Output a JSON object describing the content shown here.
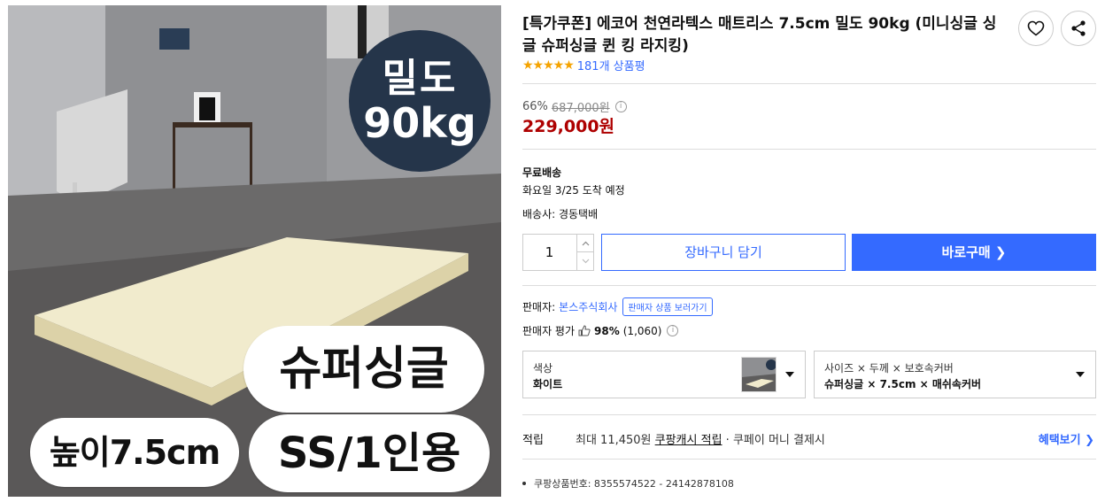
{
  "product_image": {
    "badge_line1": "밀도",
    "badge_line2": "90kg",
    "type_label": "슈퍼싱글",
    "height_label": "높이7.5cm",
    "size_label": "SS/1인용"
  },
  "product": {
    "title": "[특가쿠폰] 에코어 천연라텍스 매트리스 7.5cm 밀도 90kg (미니싱글 싱글 슈퍼싱글 퀸 킹 라지킹)",
    "stars": "★★★★★",
    "review_count": "181개 상품평"
  },
  "actions": {
    "wishlist_icon": "heart-icon",
    "share_icon": "share-icon"
  },
  "price": {
    "discount_rate": "66%",
    "original": "687,000원",
    "sale": "229,000원",
    "info_icon": "i"
  },
  "shipping": {
    "free": "무료배송",
    "arrival": "화요일 3/25 도착 예정",
    "carrier": "배송사: 경동택배"
  },
  "purchase": {
    "quantity": "1",
    "cart_label": "장바구니 담기",
    "buy_label": "바로구매 ❯"
  },
  "seller": {
    "label": "판매자:",
    "name": "본스주식회사",
    "more_label": "판매자 상품 보러가기",
    "rating_label": "판매자 평가",
    "rating_pct": "98%",
    "rating_count": "(1,060)"
  },
  "options": {
    "color": {
      "label": "색상",
      "value": "화이트"
    },
    "size": {
      "label": "사이즈 × 두께 × 보호속커버",
      "value": "슈퍼싱글 × 7.5cm × 매쉬속커버"
    }
  },
  "reward": {
    "label": "적립",
    "prefix": "최대 11,450원 ",
    "link": "쿠팡캐시 적립",
    "suffix": " · 쿠페이 머니 결제시",
    "more": "혜택보기 ❯"
  },
  "product_id": "쿠팡상품번호: 8355574522 - 24142878108",
  "colors": {
    "accent": "#346aff",
    "sale": "#ae0000",
    "stars": "#f5a300",
    "badge": "#25354a"
  }
}
